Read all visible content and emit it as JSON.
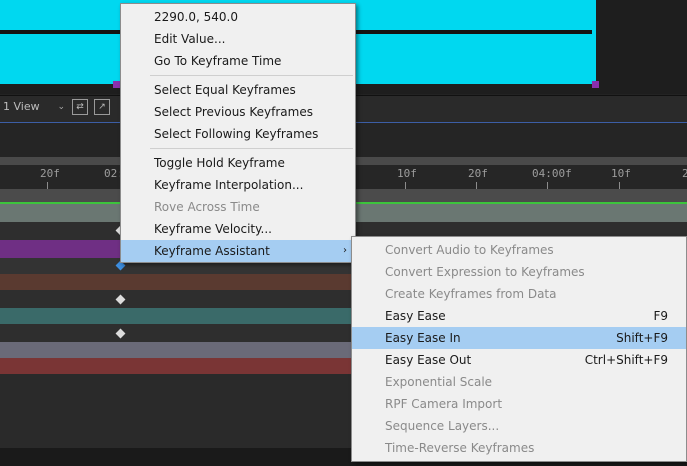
{
  "viewer": {
    "view_select": "1 View",
    "comp_color": "#00d8f0"
  },
  "timeline": {
    "ruler_labels": [
      "20f",
      "02:",
      "10f",
      "20f",
      "04:00f",
      "10f",
      "2"
    ]
  },
  "context_menu": {
    "items": [
      {
        "label": "2290.0, 540.0",
        "disabled": false
      },
      {
        "label": "Edit Value...",
        "disabled": false
      },
      {
        "label": "Go To Keyframe Time",
        "disabled": false
      },
      {
        "label": "Select Equal Keyframes",
        "disabled": false
      },
      {
        "label": "Select Previous Keyframes",
        "disabled": false
      },
      {
        "label": "Select Following Keyframes",
        "disabled": false
      },
      {
        "label": "Toggle Hold Keyframe",
        "disabled": false
      },
      {
        "label": "Keyframe Interpolation...",
        "disabled": false
      },
      {
        "label": "Rove Across Time",
        "disabled": true
      },
      {
        "label": "Keyframe Velocity...",
        "disabled": false
      },
      {
        "label": "Keyframe Assistant",
        "disabled": false,
        "highlighted": true,
        "submenu_arrow": "›"
      }
    ]
  },
  "submenu": {
    "items": [
      {
        "label": "Convert Audio to Keyframes",
        "disabled": true
      },
      {
        "label": "Convert Expression to Keyframes",
        "disabled": true
      },
      {
        "label": "Create Keyframes from Data",
        "disabled": true
      },
      {
        "label": "Easy Ease",
        "shortcut": "F9",
        "disabled": false
      },
      {
        "label": "Easy Ease In",
        "shortcut": "Shift+F9",
        "disabled": false,
        "highlighted": true
      },
      {
        "label": "Easy Ease Out",
        "shortcut": "Ctrl+Shift+F9",
        "disabled": false
      },
      {
        "label": "Exponential Scale",
        "disabled": true
      },
      {
        "label": "RPF Camera Import",
        "disabled": true
      },
      {
        "label": "Sequence Layers...",
        "disabled": true
      },
      {
        "label": "Time-Reverse Keyframes",
        "disabled": true
      }
    ]
  },
  "colors": {
    "highlight": "#a5cdf2",
    "menu_bg": "#f0f0f0",
    "keyframe_selected": "#3d8ee0"
  }
}
